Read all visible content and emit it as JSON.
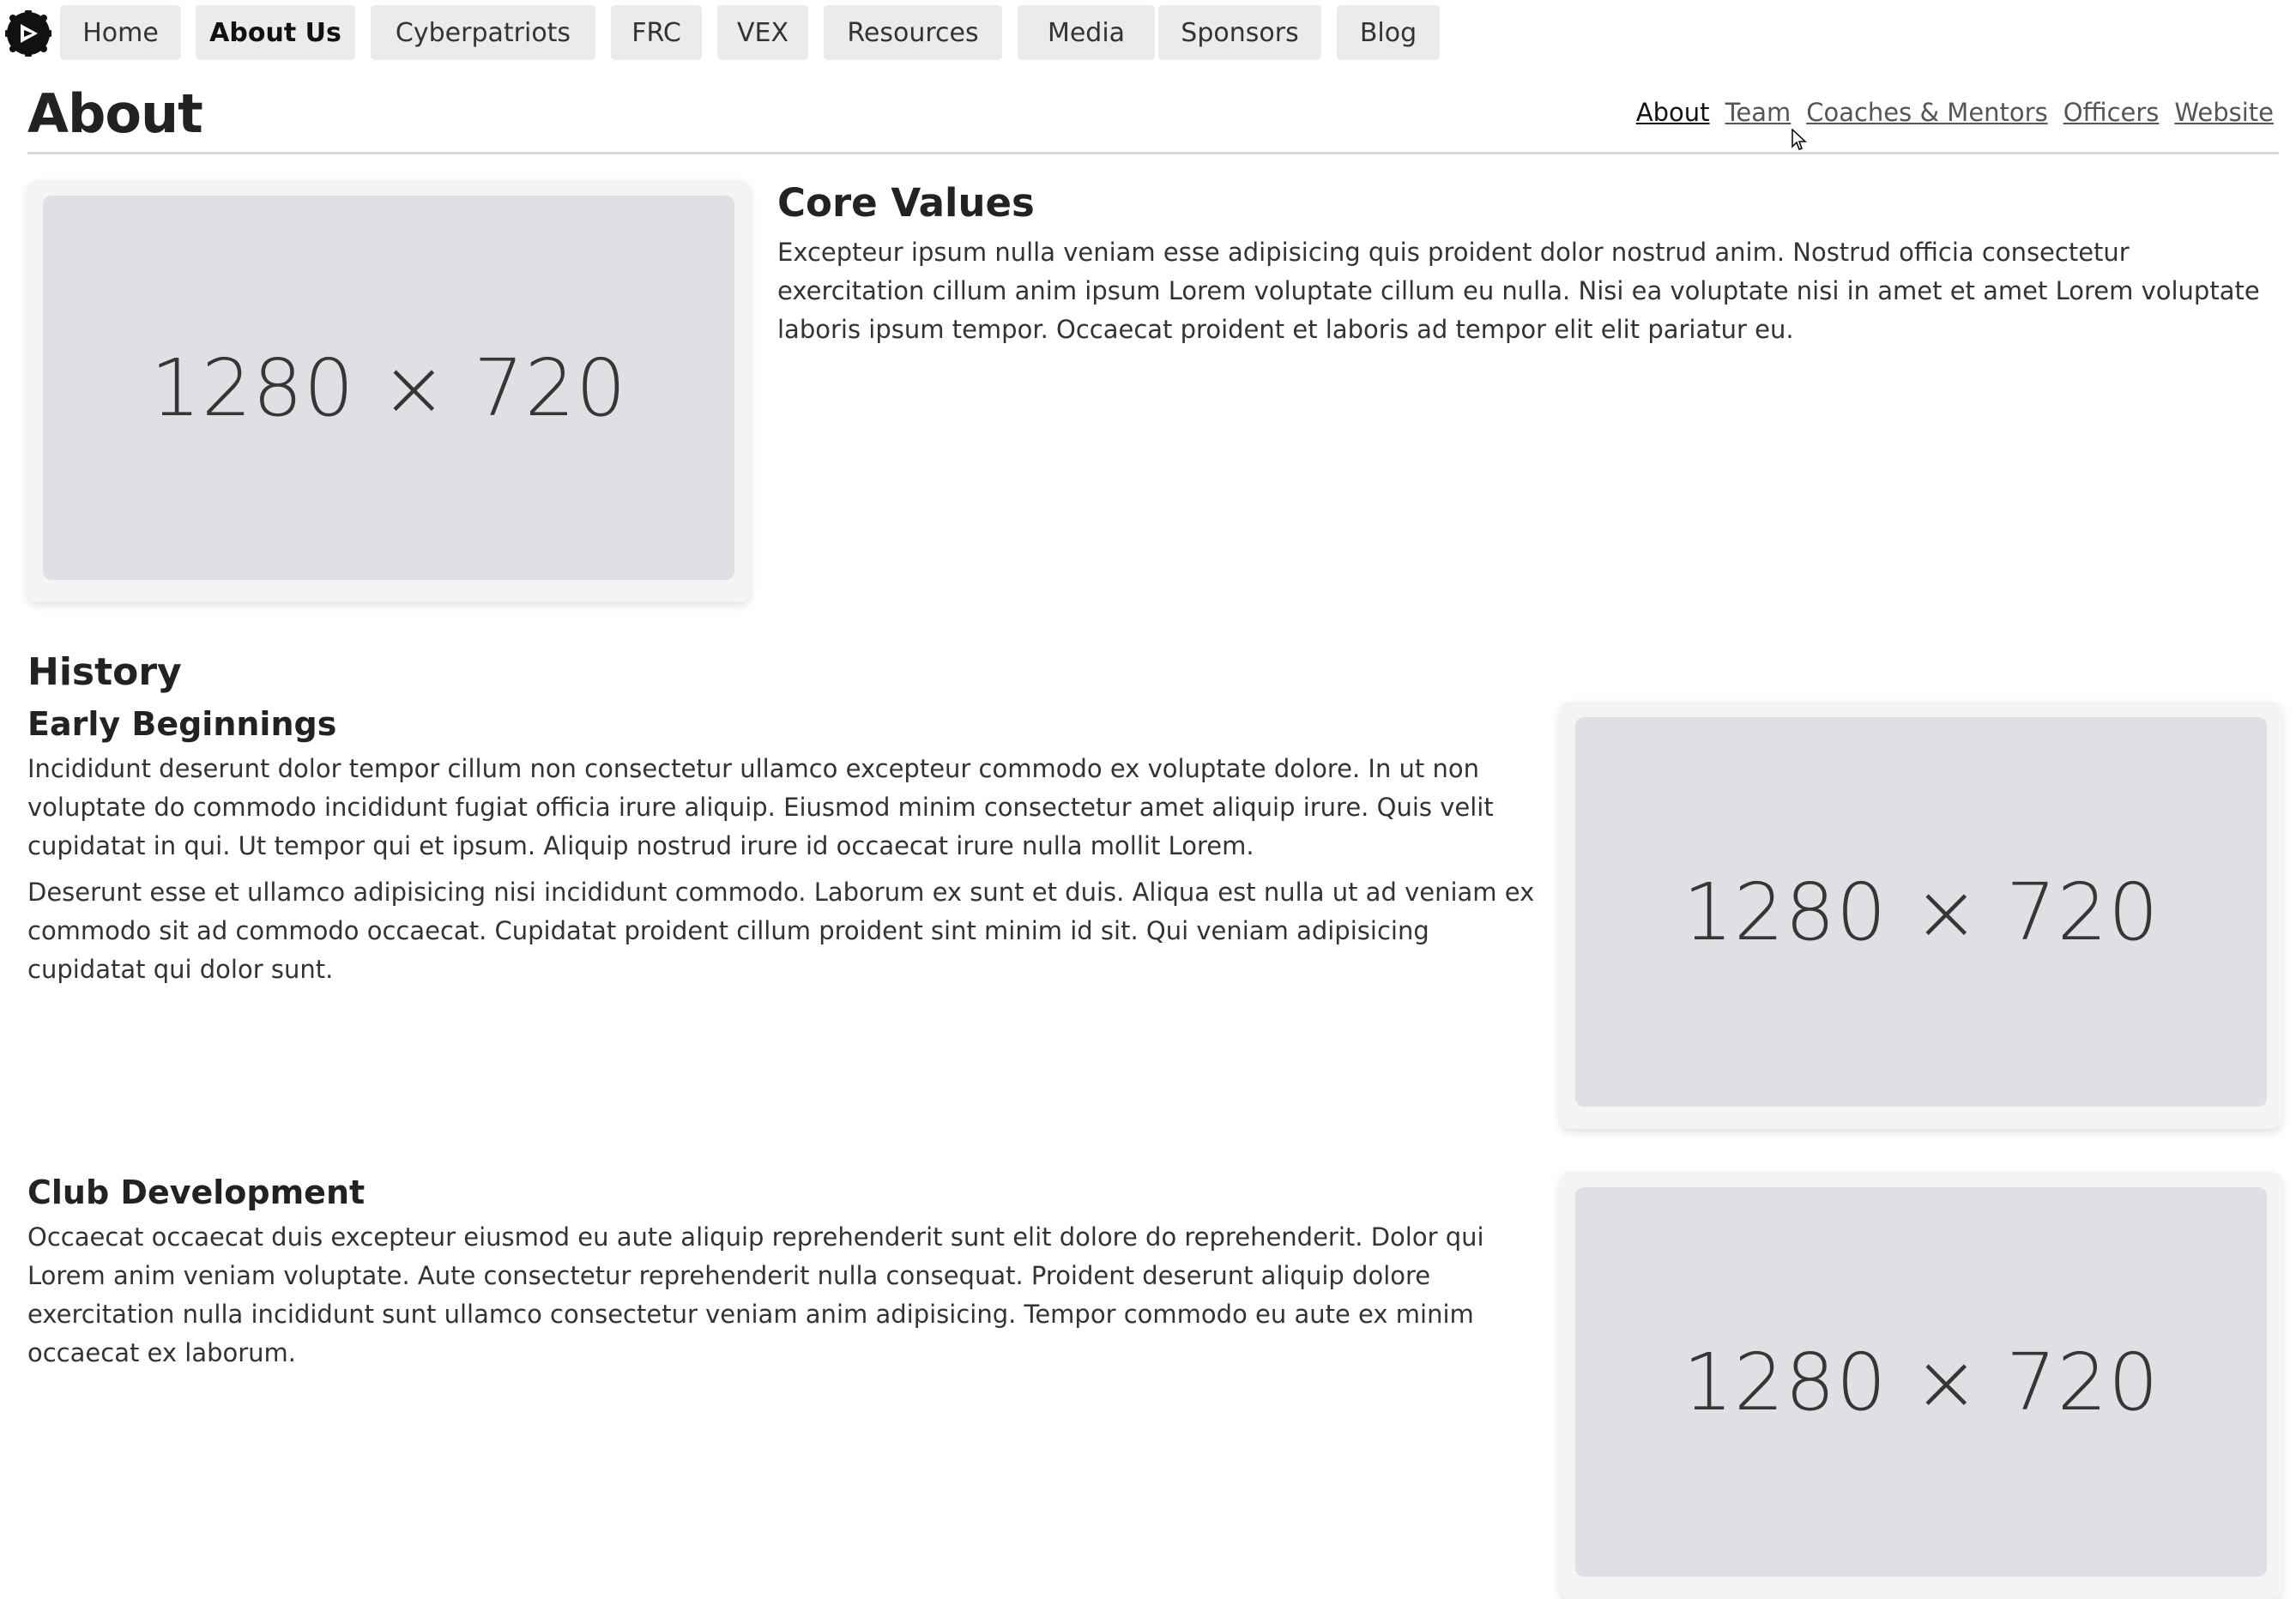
{
  "nav": {
    "logo_icon": "club-logo-icon",
    "items": [
      {
        "label": "Home"
      },
      {
        "label": "About Us",
        "active": true
      },
      {
        "label": "Cyberpatriots"
      },
      {
        "label": "FRC"
      },
      {
        "label": "VEX"
      },
      {
        "label": "Resources"
      },
      {
        "label": "Media"
      },
      {
        "label": "Sponsors"
      },
      {
        "label": "Blog"
      }
    ]
  },
  "page": {
    "title": "About",
    "subnav": [
      {
        "label": "About",
        "active": true
      },
      {
        "label": "Team"
      },
      {
        "label": "Coaches & Mentors"
      },
      {
        "label": "Officers"
      },
      {
        "label": "Website"
      }
    ]
  },
  "core_values": {
    "image_text": "1280 × 720",
    "heading": "Core Values",
    "text": "Excepteur ipsum nulla veniam esse adipisicing quis proident dolor nostrud anim. Nostrud officia consectetur exercitation cillum anim ipsum Lorem voluptate cillum eu nulla. Nisi ea voluptate nisi in amet et amet Lorem voluptate laboris ipsum tempor. Occaecat proident et laboris ad tempor elit elit pariatur eu."
  },
  "history": {
    "heading": "History",
    "early": {
      "heading": "Early Beginnings",
      "p1": "Incididunt deserunt dolor tempor cillum non consectetur ullamco excepteur commodo ex voluptate dolore. In ut non voluptate do commodo incididunt fugiat officia irure aliquip. Eiusmod minim consectetur amet aliquip irure. Quis velit cupidatat in qui. Ut tempor qui et ipsum. Aliquip nostrud irure id occaecat irure nulla mollit Lorem.",
      "p2": "Deserunt esse et ullamco adipisicing nisi incididunt commodo. Laborum ex sunt et duis. Aliqua est nulla ut ad veniam ex commodo sit ad commodo occaecat. Cupidatat proident cillum proident sint minim id sit. Qui veniam adipisicing cupidatat qui dolor sunt.",
      "image_text": "1280 × 720"
    },
    "club_dev": {
      "heading": "Club Development",
      "p1": "Occaecat occaecat duis excepteur eiusmod eu aute aliquip reprehenderit sunt elit dolore do reprehenderit. Dolor qui Lorem anim veniam voluptate. Aute consectetur reprehenderit nulla consequat. Proident deserunt aliquip dolore exercitation nulla incididunt sunt ullamco consectetur veniam anim adipisicing. Tempor commodo eu aute ex minim occaecat ex laborum.",
      "image_text": "1280 × 720"
    }
  }
}
